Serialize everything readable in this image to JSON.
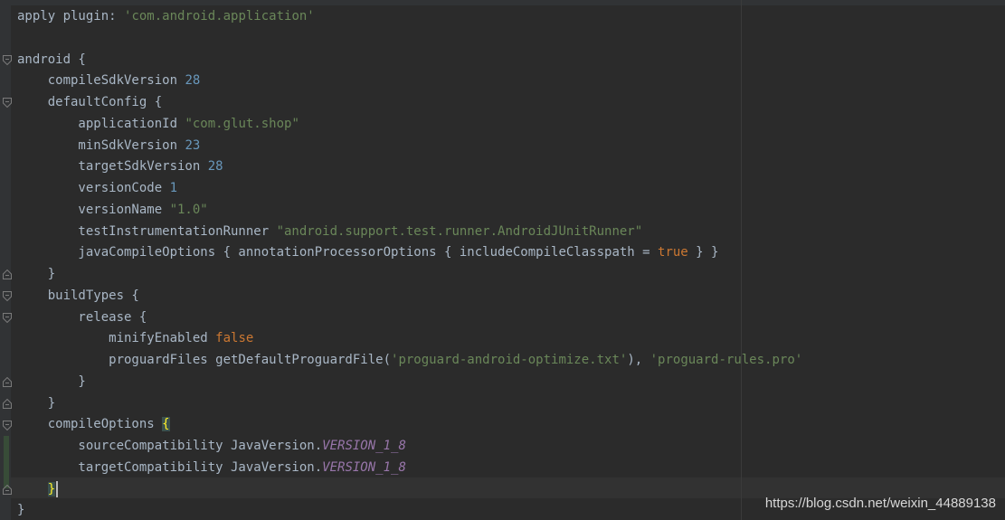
{
  "editor": {
    "code_lines": [
      [
        {
          "t": "apply plugin: "
        },
        {
          "t": "'com.android.application'",
          "c": "str"
        }
      ],
      [],
      [
        {
          "t": "android {"
        }
      ],
      [
        {
          "t": "    compileSdkVersion "
        },
        {
          "t": "28",
          "c": "num"
        }
      ],
      [
        {
          "t": "    defaultConfig {"
        }
      ],
      [
        {
          "t": "        applicationId "
        },
        {
          "t": "\"com.glut.shop\"",
          "c": "str"
        }
      ],
      [
        {
          "t": "        minSdkVersion "
        },
        {
          "t": "23",
          "c": "num"
        }
      ],
      [
        {
          "t": "        targetSdkVersion "
        },
        {
          "t": "28",
          "c": "num"
        }
      ],
      [
        {
          "t": "        versionCode "
        },
        {
          "t": "1",
          "c": "num"
        }
      ],
      [
        {
          "t": "        versionName "
        },
        {
          "t": "\"1.0\"",
          "c": "str"
        }
      ],
      [
        {
          "t": "        testInstrumentationRunner "
        },
        {
          "t": "\"android.support.test.runner.AndroidJUnitRunner\"",
          "c": "str"
        }
      ],
      [
        {
          "t": "        javaCompileOptions { annotationProcessorOptions { includeCompileClasspath = "
        },
        {
          "t": "true",
          "c": "kw"
        },
        {
          "t": " } }"
        }
      ],
      [
        {
          "t": "    }"
        }
      ],
      [
        {
          "t": "    buildTypes {"
        }
      ],
      [
        {
          "t": "        release {"
        }
      ],
      [
        {
          "t": "            minifyEnabled "
        },
        {
          "t": "false",
          "c": "kw"
        }
      ],
      [
        {
          "t": "            proguardFiles getDefaultProguardFile("
        },
        {
          "t": "'proguard-android-optimize.txt'",
          "c": "str"
        },
        {
          "t": "), "
        },
        {
          "t": "'proguard-rules.pro'",
          "c": "str"
        }
      ],
      [
        {
          "t": "        }"
        }
      ],
      [
        {
          "t": "    }"
        }
      ],
      [
        {
          "t": "    compileOptions "
        },
        {
          "t": "{",
          "c": "brace-hl"
        }
      ],
      [
        {
          "t": "        sourceCompatibility JavaVersion."
        },
        {
          "t": "VERSION_1_8",
          "c": "const"
        }
      ],
      [
        {
          "t": "        targetCompatibility JavaVersion."
        },
        {
          "t": "VERSION_1_8",
          "c": "const"
        }
      ],
      [
        {
          "t": "    "
        },
        {
          "t": "}",
          "c": "brace-hl"
        },
        {
          "caret": true
        }
      ],
      [
        {
          "t": "}"
        }
      ]
    ],
    "fold_markers": [
      {
        "line": 2,
        "kind": "open"
      },
      {
        "line": 4,
        "kind": "open"
      },
      {
        "line": 12,
        "kind": "close"
      },
      {
        "line": 13,
        "kind": "open"
      },
      {
        "line": 14,
        "kind": "open"
      },
      {
        "line": 17,
        "kind": "close"
      },
      {
        "line": 18,
        "kind": "close"
      },
      {
        "line": 19,
        "kind": "open"
      },
      {
        "line": 22,
        "kind": "close"
      }
    ]
  },
  "colors": {
    "background": "#2b2b2b",
    "default_text": "#a9b7c6",
    "string": "#6a8759",
    "number": "#6897bb",
    "keyword": "#cc7832",
    "constant": "#9876aa",
    "brace_match": "#ffef28"
  },
  "watermark": "https://blog.csdn.net/weixin_44889138"
}
